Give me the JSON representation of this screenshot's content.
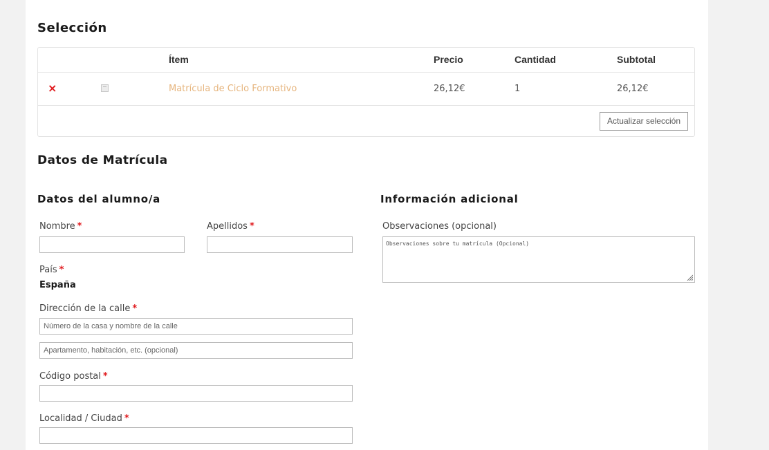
{
  "selection": {
    "title": "Selección",
    "table": {
      "headers": {
        "item": "Ítem",
        "price": "Precio",
        "quantity": "Cantidad",
        "subtotal": "Subtotal"
      },
      "rows": [
        {
          "remove": "×",
          "product": "Matrícula de Ciclo Formativo",
          "price": "26,12€",
          "quantity": "1",
          "subtotal": "26,12€"
        }
      ]
    },
    "update_button": "Actualizar selección"
  },
  "form": {
    "title": "Datos de Matrícula",
    "student": {
      "title": "Datos del alumno/a",
      "required_mark": "*",
      "first_name_label": "Nombre",
      "last_name_label": "Apellidos",
      "country_label": "País",
      "country_value": "España",
      "street_label": "Dirección de la calle",
      "street_placeholder": "Número de la casa y nombre de la calle",
      "street2_placeholder": "Apartamento, habitación, etc. (opcional)",
      "postcode_label": "Código postal",
      "city_label": "Localidad / Ciudad"
    },
    "additional": {
      "title": "Información adicional",
      "notes_label": "Observaciones (opcional)",
      "notes_placeholder": "Observaciones sobre tu matrícula (Opcional)"
    }
  },
  "colors": {
    "accent_link": "#e6b57e",
    "required": "#e0191d",
    "background": "#f2f2f2"
  }
}
